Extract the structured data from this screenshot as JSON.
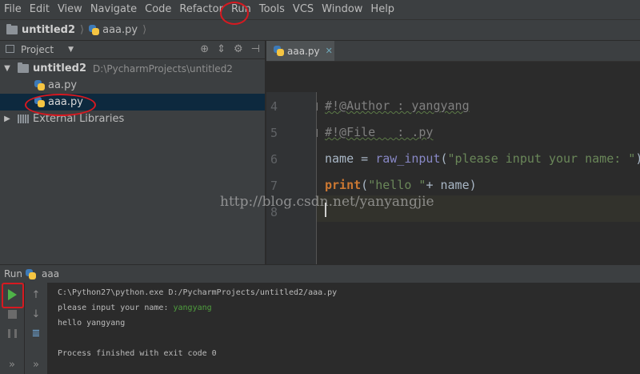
{
  "menu": [
    "File",
    "Edit",
    "View",
    "Navigate",
    "Code",
    "Refactor",
    "Run",
    "Tools",
    "VCS",
    "Window",
    "Help"
  ],
  "breadcrumb": {
    "project": "untitled2",
    "file": "aaa.py"
  },
  "project_panel": {
    "title": "Project",
    "root_name": "untitled2",
    "root_path": "D:\\PycharmProjects\\untitled2",
    "files": [
      "aa.py",
      "aaa.py"
    ],
    "libraries": "External Libraries"
  },
  "editor": {
    "tab": "aaa.py",
    "lines": [
      {
        "num": "4",
        "parts": [
          {
            "t": "#!@Author : yangyang",
            "c": "cm"
          }
        ]
      },
      {
        "num": "5",
        "parts": [
          {
            "t": "#!@File   : .py",
            "c": "cm"
          }
        ]
      },
      {
        "num": "6",
        "parts": [
          {
            "t": "name = ",
            "c": ""
          },
          {
            "t": "raw_input",
            "c": "fn"
          },
          {
            "t": "(",
            "c": ""
          },
          {
            "t": "\"please input your name: \"",
            "c": "str"
          },
          {
            "t": ")",
            "c": ""
          }
        ]
      },
      {
        "num": "7",
        "parts": [
          {
            "t": "print",
            "c": "kw"
          },
          {
            "t": "(",
            "c": ""
          },
          {
            "t": "\"hello \"",
            "c": "str"
          },
          {
            "t": "+ name)",
            "c": ""
          }
        ]
      },
      {
        "num": "8",
        "parts": []
      }
    ]
  },
  "watermark": "http://blog.csdn.net/yanyangjie",
  "run_panel": {
    "label": "Run",
    "config": "aaa",
    "console": [
      {
        "t": "C:\\Python27\\python.exe D:/PycharmProjects/untitled2/aaa.py"
      },
      {
        "t": "please input your name: ",
        "input": "yangyang"
      },
      {
        "t": "hello yangyang"
      },
      {
        "t": ""
      },
      {
        "t": "Process finished with exit code 0"
      }
    ]
  },
  "colors": {
    "accent_run": "#4fb348",
    "annotation": "#d71920",
    "selection": "#0d293e"
  }
}
